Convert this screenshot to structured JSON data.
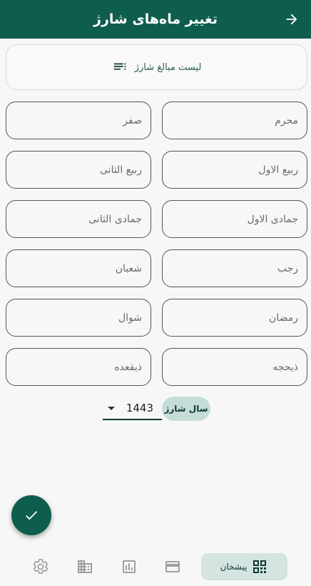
{
  "header": {
    "title": "تغییر ماه‌های شارژ",
    "back_icon": "arrow-forward-icon"
  },
  "list_card": {
    "label": "لیست مبالغ شارژ",
    "icon": "list-icon"
  },
  "months": [
    {
      "placeholder": "محرم"
    },
    {
      "placeholder": "صفر"
    },
    {
      "placeholder": "ربیع الاول"
    },
    {
      "placeholder": "ربیع الثانی"
    },
    {
      "placeholder": "جمادی الاول"
    },
    {
      "placeholder": "جمادی الثانی"
    },
    {
      "placeholder": "رجب"
    },
    {
      "placeholder": "شعبان"
    },
    {
      "placeholder": "رمضان"
    },
    {
      "placeholder": "شوال"
    },
    {
      "placeholder": "ذیحجه"
    },
    {
      "placeholder": "ذیقعده"
    }
  ],
  "year": {
    "label": "سال شارژ",
    "value": "1443"
  },
  "fab": {
    "icon": "check-icon"
  },
  "bottom_nav": {
    "items": [
      {
        "label": "پیشخان",
        "icon": "dashboard-icon",
        "active": true
      },
      {
        "icon": "credit-card-icon"
      },
      {
        "icon": "chart-icon"
      },
      {
        "icon": "building-icon"
      },
      {
        "icon": "settings-icon"
      }
    ]
  },
  "colors": {
    "primary": "#0f5e4d",
    "chip": "#c6dcd8",
    "nav_active": "#d3e4e1",
    "background": "#f7f7f7"
  }
}
